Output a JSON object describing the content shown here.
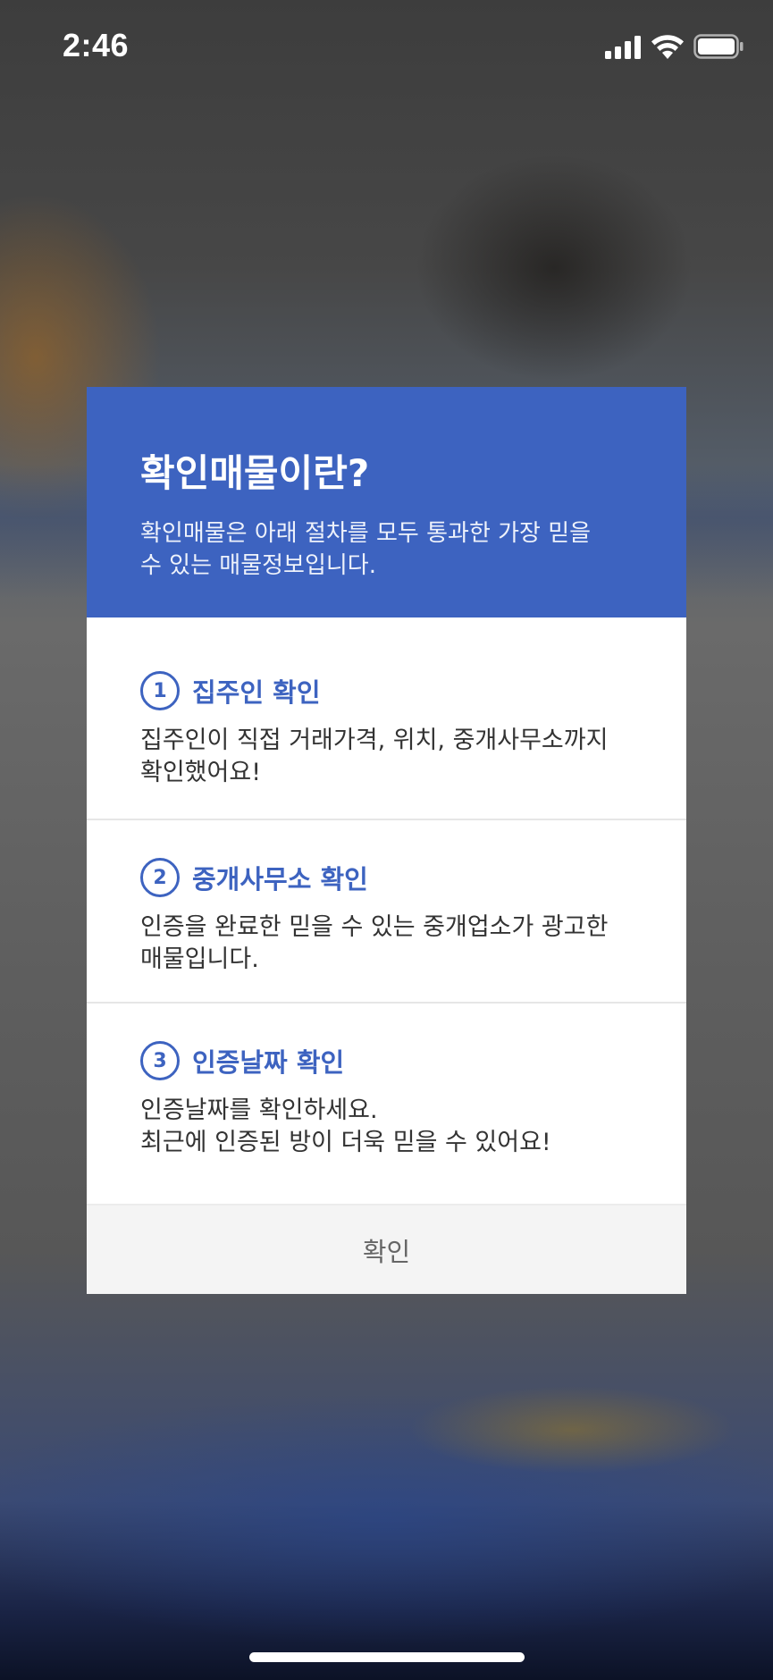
{
  "status_bar": {
    "time": "2:46",
    "icons": [
      "cellular-signal-icon",
      "wifi-icon",
      "battery-icon"
    ]
  },
  "dialog": {
    "title": "확인매물이란?",
    "subtitle": "확인매물은 아래 절차를 모두 통과한 가장 믿을\n수 있는 매물정보입니다.",
    "steps": [
      {
        "number": "1",
        "title": "집주인 확인",
        "description": "집주인이 직접 거래가격, 위치, 중개사무소까지\n 확인했어요!"
      },
      {
        "number": "2",
        "title": "중개사무소 확인",
        "description": "인증을 완료한 믿을 수 있는 중개업소가 광고한\n매물입니다."
      },
      {
        "number": "3",
        "title": "인증날짜 확인",
        "description": "인증날짜를 확인하세요.\n최근에 인증된 방이 더욱 믿을 수 있어요!"
      }
    ],
    "confirm_label": "확인"
  },
  "colors": {
    "accent": "#3d63c0",
    "footer_bg": "#f4f4f4",
    "text": "#333333"
  }
}
